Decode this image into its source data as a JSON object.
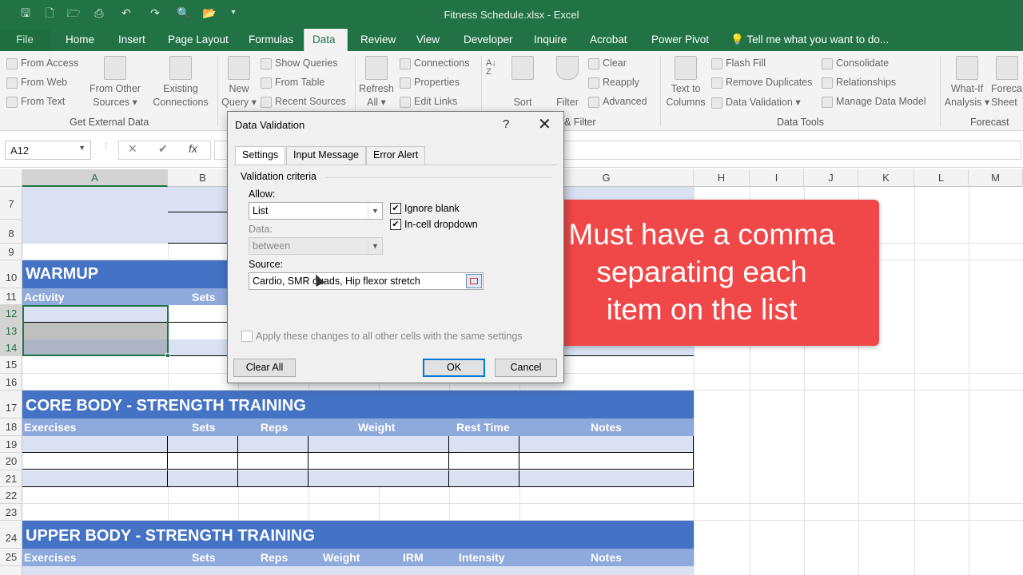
{
  "window": {
    "title": "Fitness Schedule.xlsx - Excel"
  },
  "tabs": [
    {
      "label": "File"
    },
    {
      "label": "Home"
    },
    {
      "label": "Insert"
    },
    {
      "label": "Page Layout"
    },
    {
      "label": "Formulas"
    },
    {
      "label": "Data"
    },
    {
      "label": "Review"
    },
    {
      "label": "View"
    },
    {
      "label": "Developer"
    },
    {
      "label": "Inquire"
    },
    {
      "label": "Acrobat"
    },
    {
      "label": "Power Pivot"
    }
  ],
  "tell_me": "Tell me what you want to do...",
  "ribbon": {
    "from_access": "From Access",
    "from_web": "From Web",
    "from_text": "From Text",
    "from_other": "From Other",
    "sources": "Sources",
    "existing": "Existing",
    "connections_big": "Connections",
    "group_external": "Get External Data",
    "new": "New",
    "query": "Query",
    "show_queries": "Show Queries",
    "from_table": "From Table",
    "recent_sources": "Recent Sources",
    "refresh": "Refresh",
    "all": "All",
    "connections": "Connections",
    "properties": "Properties",
    "edit_links": "Edit Links",
    "sort": "Sort",
    "filter": "Filter",
    "clear": "Clear",
    "reapply": "Reapply",
    "advanced": "Advanced",
    "group_sort": "& Filter",
    "text_to": "Text to",
    "columns": "Columns",
    "flash_fill": "Flash Fill",
    "remove_duplicates": "Remove Duplicates",
    "data_validation": "Data Validation",
    "consolidate": "Consolidate",
    "relationships": "Relationships",
    "manage_model": "Manage Data Model",
    "group_tools": "Data Tools",
    "what_if": "What-If",
    "analysis": "Analysis",
    "forecast_sheet_1": "Foreca",
    "forecast_sheet_2": "Sheet",
    "group_forecast": "Forecast"
  },
  "namebox": "A12",
  "fx": "fx",
  "columns": [
    "A",
    "B",
    "G",
    "H",
    "I",
    "J",
    "K",
    "L",
    "M"
  ],
  "rows": [
    "7",
    "8",
    "9",
    "10",
    "11",
    "12",
    "13",
    "14",
    "15",
    "16",
    "17",
    "18",
    "19",
    "20",
    "21",
    "22",
    "23",
    "24",
    "25"
  ],
  "sheet": {
    "warmup": "WARMUP",
    "warmup_activity": "Activity",
    "warmup_sets": "Sets",
    "core": "CORE BODY - STRENGTH TRAINING",
    "core_headers": [
      "Exercises",
      "Sets",
      "Reps",
      "Weight",
      "Rest Time",
      "Notes"
    ],
    "upper": "UPPER BODY - STRENGTH TRAINING",
    "upper_headers": [
      "Exercises",
      "Sets",
      "Reps",
      "Weight",
      "IRM",
      "Intensity",
      "Notes"
    ]
  },
  "dialog": {
    "title": "Data Validation",
    "help": "?",
    "close": "✕",
    "tabs": [
      "Settings",
      "Input Message",
      "Error Alert"
    ],
    "criteria": "Validation criteria",
    "allow_label": "Allow:",
    "allow_value": "List",
    "data_label": "Data:",
    "data_value": "between",
    "ignore_blank": "Ignore blank",
    "in_cell_dropdown": "In-cell dropdown",
    "source_label": "Source:",
    "source_value": "Cardio, SMR quads, Hip flexor stretch",
    "apply_all": "Apply these changes to all other cells with the same settings",
    "clear_all": "Clear All",
    "ok": "OK",
    "cancel": "Cancel"
  },
  "callout": {
    "line1": "Must have a comma",
    "line2": "separating each",
    "line3": "item on the list"
  },
  "colors": {
    "excel_green": "#217346",
    "band_blue": "#4472c4",
    "sub_blue": "#8ea9db",
    "row_blue": "#d9e1f2",
    "callout_red": "#f04848"
  }
}
